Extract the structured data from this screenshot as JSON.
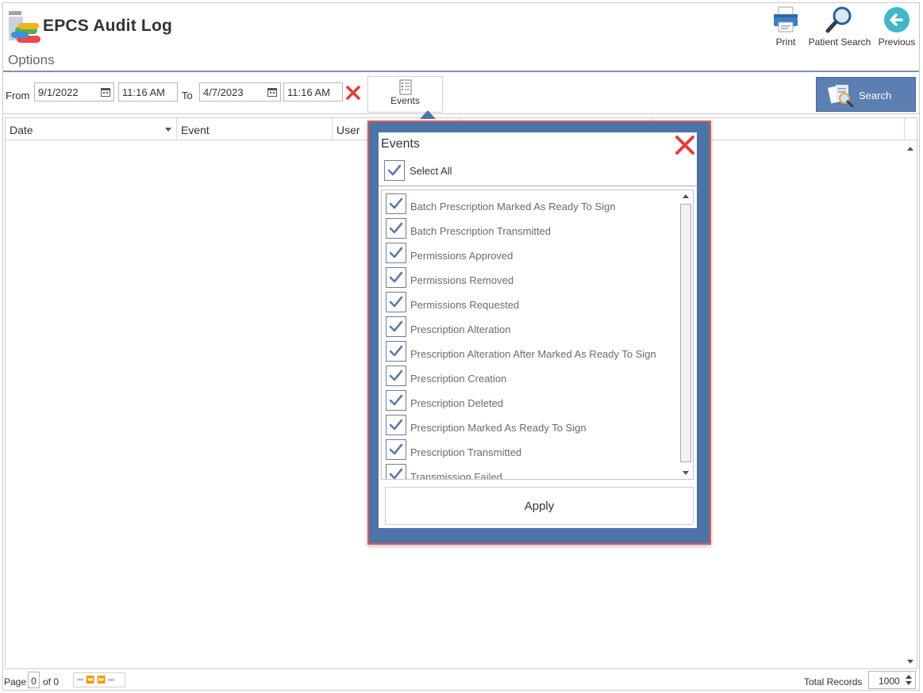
{
  "app": {
    "title": "EPCS Audit Log",
    "options_label": "Options"
  },
  "toolbar": {
    "print_label": "Print",
    "patient_search_label": "Patient Search",
    "previous_label": "Previous"
  },
  "filters": {
    "from_label": "From",
    "from_date": "9/1/2022",
    "from_time": "11:16 AM",
    "to_label": "To",
    "to_date": "4/7/2023",
    "to_time": "11:16 AM",
    "events_label": "Events",
    "search_label": "Search"
  },
  "grid": {
    "columns": [
      "Date",
      "Event",
      "User"
    ]
  },
  "footer": {
    "page_label": "Page",
    "page_value": "0",
    "of_label": "of 0",
    "total_label": "Total Records",
    "total_value": "1000"
  },
  "events_popup": {
    "title": "Events",
    "select_all_label": "Select All",
    "apply_label": "Apply",
    "items": [
      "Batch Prescription Marked As Ready To Sign",
      "Batch Prescription Transmitted",
      "Permissions Approved",
      "Permissions Removed",
      "Permissions Requested",
      "Prescription Alteration",
      "Prescription Alteration After Marked As Ready To Sign",
      "Prescription Creation",
      "Prescription Deleted",
      "Prescription Marked As Ready To Sign",
      "Prescription Transmitted",
      "Transmission Failed"
    ]
  },
  "colors": {
    "accent": "#4c74a8",
    "search_button": "#5a7fb0",
    "popup_border": "#e05a50",
    "clear_red": "#e63b3b",
    "check": "#5b7cad"
  },
  "icons": [
    "app-logo-icon",
    "printer-icon",
    "magnifier-icon",
    "back-arrow-icon",
    "calendar-icon",
    "clear-x-icon",
    "events-list-icon",
    "search-documents-icon",
    "checkmark-icon",
    "close-x-icon"
  ]
}
